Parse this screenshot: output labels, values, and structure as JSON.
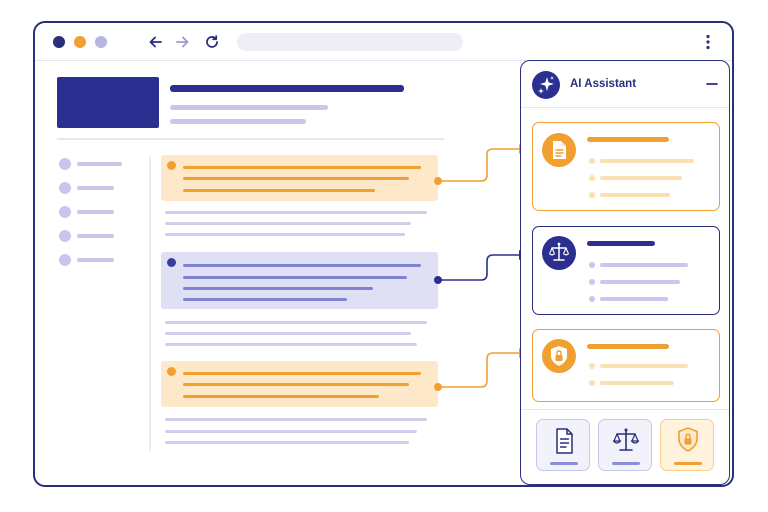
{
  "assistant": {
    "title": "AI Assistant"
  },
  "colors": {
    "primary": "#2b2f7a",
    "accent": "#f0a030",
    "muted": "#c7c7ec"
  },
  "icons": {
    "back": "arrow-left-icon",
    "forward": "arrow-right-icon",
    "reload": "reload-icon",
    "menu": "kebab-menu-icon",
    "assistant": "sparkle-icon",
    "collapse": "minus-icon",
    "document": "document-icon",
    "legal": "scales-icon",
    "security": "shield-lock-icon"
  }
}
